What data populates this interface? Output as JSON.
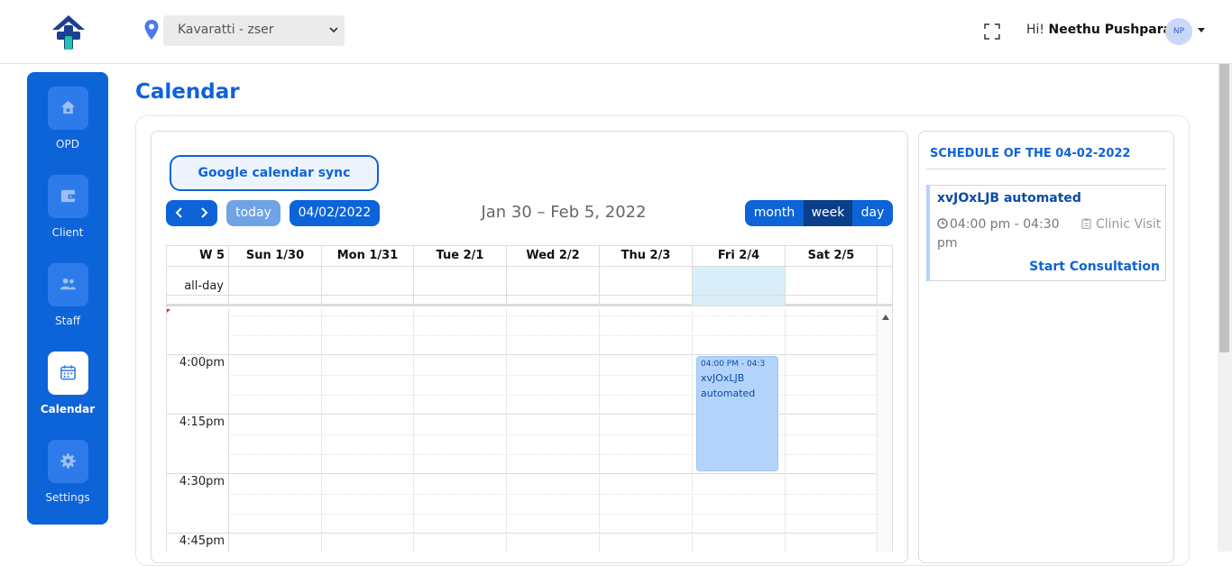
{
  "header": {
    "location": "Kavaratti - zser",
    "greeting": "Hi!",
    "user_name": "Neethu Pushparaj",
    "avatar_initials": "NP"
  },
  "sidebar": {
    "items": [
      {
        "label": "OPD",
        "icon": "home-icon"
      },
      {
        "label": "Client",
        "icon": "wallet-icon"
      },
      {
        "label": "Staff",
        "icon": "users-icon"
      },
      {
        "label": "Calendar",
        "icon": "calendar-icon",
        "active": true
      },
      {
        "label": "Settings",
        "icon": "gear-icon"
      }
    ]
  },
  "page": {
    "title": "Calendar"
  },
  "calendar": {
    "sync_button": "Google calendar sync",
    "today_label": "today",
    "current_date": "04/02/2022",
    "range_title": "Jan 30 – Feb 5, 2022",
    "views": [
      "month",
      "week",
      "day"
    ],
    "active_view": "week",
    "week_label": "W 5",
    "days": [
      "Sun 1/30",
      "Mon 1/31",
      "Tue 2/1",
      "Wed 2/2",
      "Thu 2/3",
      "Fri 2/4",
      "Sat 2/5"
    ],
    "allday_label": "all-day",
    "times": [
      "4:00pm",
      "4:15pm",
      "4:30pm",
      "4:45pm"
    ],
    "event": {
      "time": "04:00 PM - 04:3",
      "title": "xvJOxLJB automated"
    }
  },
  "schedule": {
    "title": "SCHEDULE OF THE 04-02-2022",
    "item": {
      "title": "xvJOxLJB automated",
      "time": "04:00 pm - 04:30 pm",
      "type": "Clinic Visit",
      "action": "Start Consultation"
    }
  },
  "colors": {
    "primary": "#0d63d8",
    "event_bg": "#b3d3fb",
    "today_bg": "#d9eef8"
  }
}
